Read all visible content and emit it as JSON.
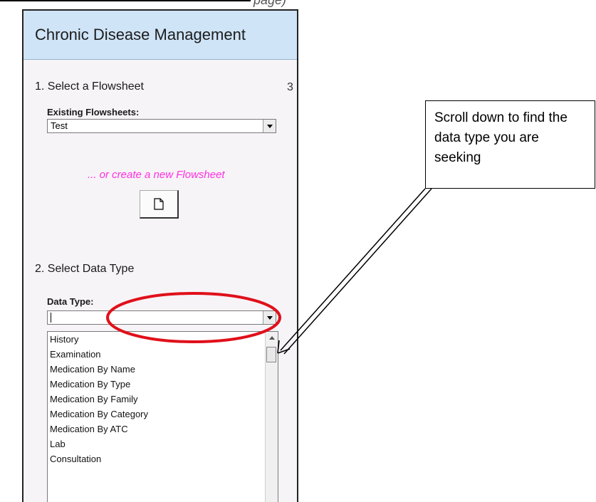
{
  "page_fragment": "page)",
  "panel": {
    "title": "Chronic Disease Management",
    "step1": "1. Select a  Flowsheet",
    "step3_hint": "3",
    "existing_label": "Existing Flowsheets:",
    "existing_value": "Test",
    "create_link": "... or create a new  Flowsheet",
    "new_button_icon": "new-document-icon",
    "step2": "2. Select Data Type",
    "datatype_label": "Data Type:",
    "datatype_value": "",
    "list_items": [
      "History",
      "Examination",
      "Medication By Name",
      "Medication By Type",
      "Medication By Family",
      "Medication By Category",
      "Medication By ATC",
      "Lab",
      "Consultation"
    ]
  },
  "callout": {
    "text": "Scroll down to find the data type you are seeking"
  },
  "colors": {
    "header_bg": "#cfe4f7",
    "panel_bg": "#f7f4f7",
    "link": "#ff2fe0",
    "highlight_ellipse": "#e0101a"
  }
}
